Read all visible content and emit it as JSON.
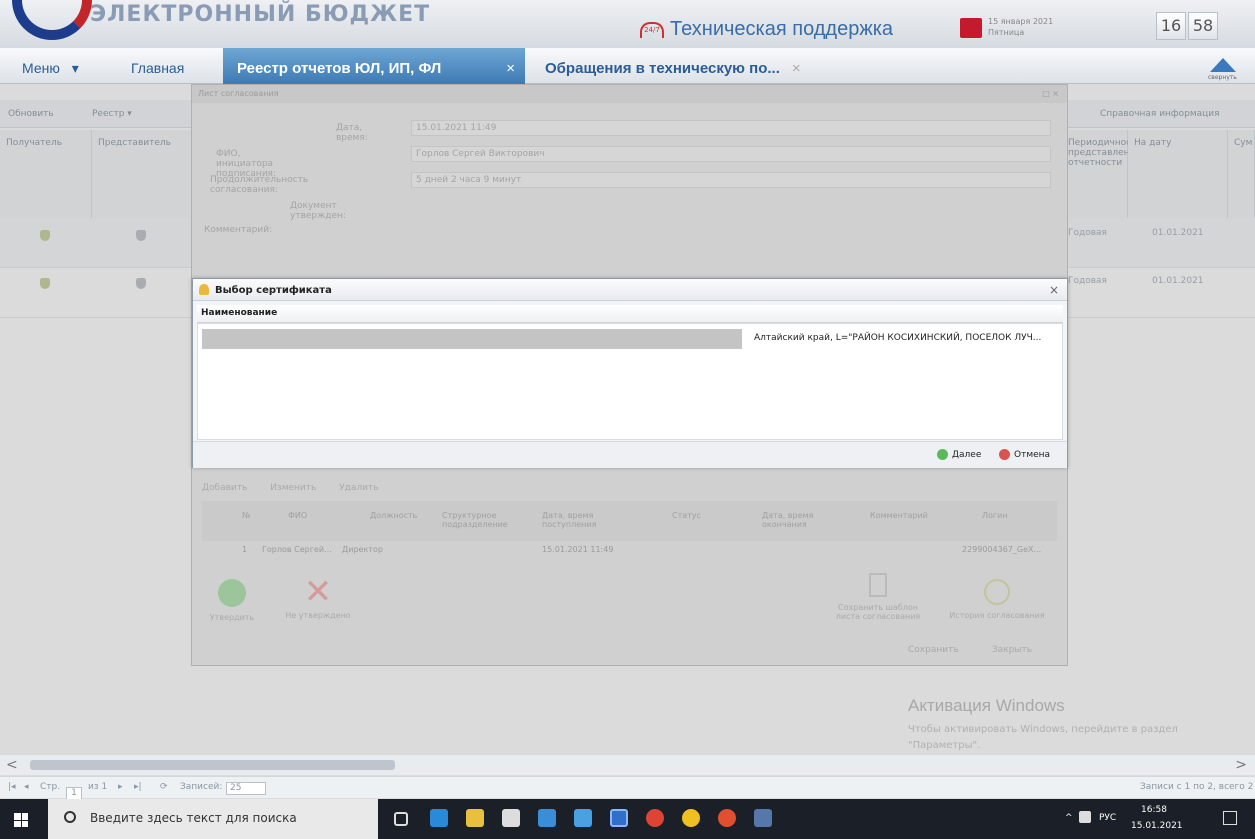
{
  "header": {
    "brand": "ЭЛЕКТРОННЫЙ БЮДЖЕТ",
    "support_prefix": "24/7",
    "support_label": "Техническая поддержка",
    "date_line1": "15 января 2021",
    "date_line2": "Пятница",
    "clock_h": "16",
    "clock_m": "58",
    "nav_up_label": "свернуть"
  },
  "nav": {
    "menu": "Меню",
    "menu_arrow": "▾",
    "home": "Главная",
    "active_tab": "Реестр отчетов ЮЛ, ИП, ФЛ",
    "active_tab_close": "×",
    "tab2": "Обращения в техническую по...",
    "tab2_close": "×"
  },
  "toolbar": {
    "refresh": "Обновить",
    "registry": "Реестр ▾",
    "ref_info": "Справочная информация"
  },
  "grid": {
    "col1": "Получатель",
    "col2": "Представитель",
    "col3": "Периодичность представления отчетности",
    "col4": "На дату",
    "col5": "Сум",
    "rows": [
      {
        "period": "Годовая",
        "date": "01.01.2021"
      },
      {
        "period": "Годовая",
        "date": "01.01.2021"
      }
    ]
  },
  "bg_dialog": {
    "title": "Лист согласования",
    "controls": "□ ×",
    "f1_label": "Дата, время:",
    "f1_val": "15.01.2021 11:49",
    "f2_label": "ФИО, инициатора подписания:",
    "f2_val": "Горлов Сергей Викторович",
    "f3_label": "Продолжительность согласования:",
    "f3_val": "5 дней 2 часа 9 минут",
    "f4_label": "Документ утвержден:",
    "comment_label": "Комментарий:",
    "sub_add": "Добавить",
    "sub_edit": "Изменить",
    "sub_remove": "Удалить",
    "cols": [
      "№",
      "ФИО",
      "Должность",
      "Структурное подразделение",
      "Дата, время поступления",
      "Статус",
      "Дата, время окончания",
      "Комментарий",
      "Логин"
    ],
    "row": [
      "1",
      "Горлов Сергей...",
      "Директор",
      "",
      "15.01.2021 11:49",
      "",
      "",
      "",
      "2299004367_GeX..."
    ],
    "approve": "Утвердить",
    "reject": "Не утверждено",
    "save_agree": "Сохранить шаблон листа согласования",
    "history": "История согласования",
    "save": "Сохранить",
    "close": "Закрыть"
  },
  "modal": {
    "title": "Выбор сертификата",
    "close": "×",
    "column": "Наименование",
    "cert_text": "Алтайский край, L=\"РАЙОН КОСИХИНСКИЙ, ПОСЕЛОК ЛУЧ...",
    "next": "Далее",
    "cancel": "Отмена"
  },
  "watermark": {
    "title": "Активация Windows",
    "text": "Чтобы активировать Windows, перейдите в раздел \"Параметры\"."
  },
  "pager": {
    "first": "|◂",
    "prev": "◂",
    "page_label": "Стр.",
    "page": "1",
    "of": "из 1",
    "next": "▸",
    "last": "▸|",
    "records_label": "Записей:",
    "records": "25",
    "summary": "Записи с 1 по 2, всего 2"
  },
  "scroll": {
    "left": "<",
    "right": ">"
  },
  "taskbar": {
    "search_placeholder": "Введите здесь текст для поиска",
    "lang": "РУС",
    "time": "16:58",
    "date": "15.01.2021",
    "tray_arrow": "^"
  }
}
